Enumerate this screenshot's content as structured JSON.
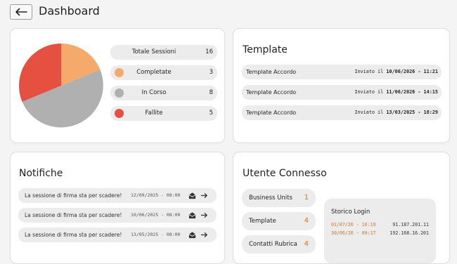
{
  "header": {
    "title": "Dashboard",
    "back_icon": "arrow-left-icon"
  },
  "sessions": {
    "rows": [
      {
        "label": "Totale Sessioni",
        "value": "16"
      },
      {
        "label": "Completate",
        "value": "3",
        "color": "#f5a96a"
      },
      {
        "label": "In Corso",
        "value": "8",
        "color": "#b0b0b0"
      },
      {
        "label": "Fallite",
        "value": "5",
        "color": "#e55040"
      }
    ],
    "chart_data": {
      "type": "pie",
      "slices": [
        {
          "label": "Completate",
          "value": 3,
          "color": "#f5a96a"
        },
        {
          "label": "In Corso",
          "value": 8,
          "color": "#b0b0b0"
        },
        {
          "label": "Fallite",
          "value": 5,
          "color": "#e55040"
        }
      ]
    }
  },
  "templates": {
    "title": "Template",
    "sent_prefix": "Inviato il",
    "items": [
      {
        "name": "Template Accordo",
        "date": "10/06/2026 - 11:21"
      },
      {
        "name": "Template Accordo",
        "date": "11/06/2026 - 14:15"
      },
      {
        "name": "Template Accordo",
        "date": "13/03/2025 - 18:29"
      }
    ]
  },
  "notifications": {
    "title": "Notifiche",
    "items": [
      {
        "message": "La sessione di firma sta per scadere!",
        "date": "12/09/2025 - 08:00"
      },
      {
        "message": "La sessione di firma sta per scadere!",
        "date": "10/06/2025 - 08:00"
      },
      {
        "message": "La sessione di firma sta per scadere!",
        "date": "13/05/2025 - 08:00"
      }
    ]
  },
  "user": {
    "title": "Utente Connesso",
    "counts": [
      {
        "label": "Business Units",
        "value": "1"
      },
      {
        "label": "Template",
        "value": "4"
      },
      {
        "label": "Contatti Rubrica",
        "value": "4"
      }
    ],
    "login": {
      "title": "Storico Login",
      "items": [
        {
          "date": "01/07/26 - 16:19",
          "ip": "91.187.201.11"
        },
        {
          "date": "30/06/26 - 09:17",
          "ip": "192.168.16.201"
        }
      ]
    }
  },
  "colors": {
    "accent": "#e0701f"
  }
}
